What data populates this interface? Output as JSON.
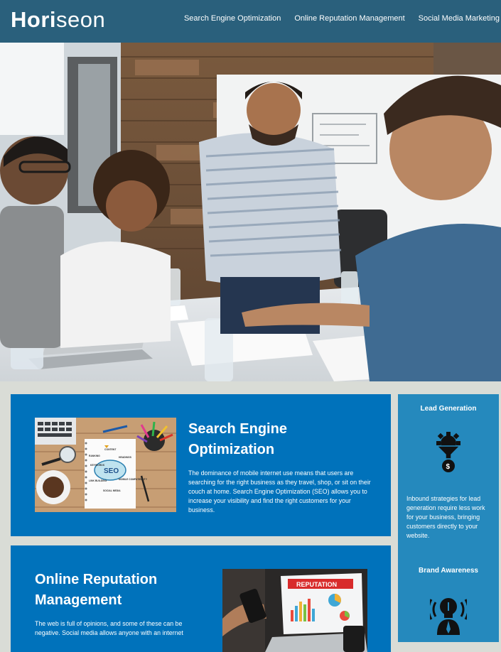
{
  "header": {
    "logo_main": "Hori",
    "logo_accent": "seon",
    "nav": [
      {
        "label": "Search Engine Optimization"
      },
      {
        "label": "Online Reputation Management"
      },
      {
        "label": "Social Media Marketing"
      }
    ]
  },
  "hero": {
    "icon": "team-meeting-photo"
  },
  "content": {
    "seo": {
      "title": "Search Engine Optimization",
      "body": "The dominance of mobile internet use means that users are searching for the right business as they travel, shop, or sit on their couch at home. Search Engine Optimization (SEO) allows you to increase your visibility and find the right customers for your business.",
      "image": {
        "icon": "seo-notebook-photo",
        "words": [
          "CONTENT",
          "RANKING",
          "HEADINGS",
          "SEO",
          "KEYWORDS",
          "LINK BUILDING",
          "MOBILE COMPATIBILITY",
          "SOCIAL MEDIA"
        ]
      }
    },
    "orm": {
      "title": "Online Reputation Management",
      "body": "The web is full of opinions, and some of these can be negative. Social media allows anyone with an internet",
      "image": {
        "icon": "reputation-laptop-photo",
        "label": "REPUTATION"
      }
    }
  },
  "aside": {
    "lead": {
      "title": "Lead Generation",
      "icon": "lead-funnel-gear-icon",
      "body": "Inbound strategies for lead generation require less work for your business, bringing customers directly to your website."
    },
    "brand": {
      "title": "Brand Awareness",
      "icon": "brand-lightbulb-person-icon"
    }
  },
  "colors": {
    "header_bg": "#2a607c",
    "page_bg": "#d9dcd6",
    "card_bg": "#0072bb",
    "aside_bg": "#2589bd",
    "text": "#ffffff"
  }
}
